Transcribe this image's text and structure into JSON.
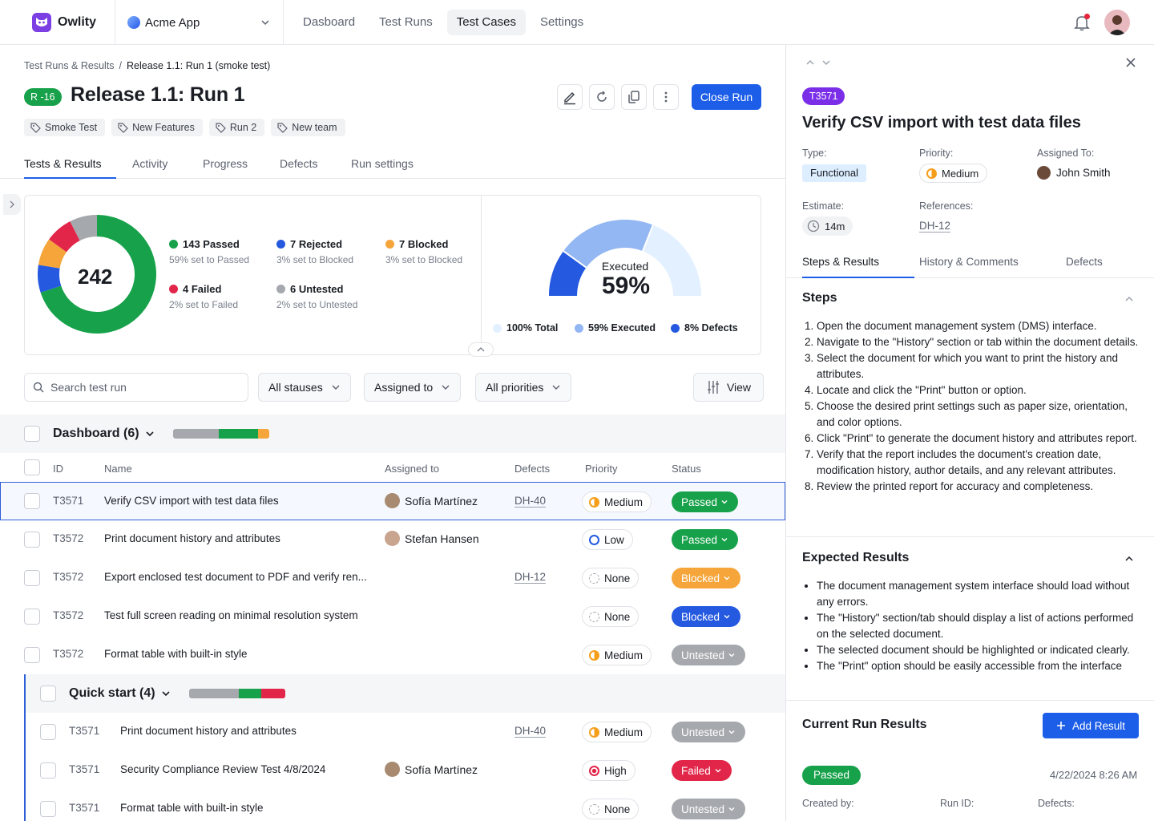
{
  "topbar": {
    "brand": "Owlity",
    "app_name": "Acme App",
    "nav": [
      "Dasboard",
      "Test Runs",
      "Test Cases",
      "Settings"
    ],
    "active_nav": "Test Cases"
  },
  "breadcrumb": {
    "parent": "Test Runs & Results",
    "separator": "/",
    "current": "Release 1.1: Run 1 (smoke test)"
  },
  "run": {
    "id_badge": "R -16",
    "title": "Release 1.1: Run 1",
    "close_label": "Close Run",
    "tags": [
      "Smoke Test",
      "New Features",
      "Run 2",
      "New team"
    ]
  },
  "tabs": [
    "Tests & Results",
    "Activity",
    "Progress",
    "Defects",
    "Run settings"
  ],
  "summary": {
    "total": "242",
    "legend": [
      {
        "label": "143 Passed",
        "sub": "59% set to Passed",
        "color": "#17a14a"
      },
      {
        "label": "7 Rejected",
        "sub": "3% set to Blocked",
        "color": "#2459e0"
      },
      {
        "label": "7 Blocked",
        "sub": "3% set to Blocked",
        "color": "#f5a53a"
      },
      {
        "label": "4 Failed",
        "sub": "2% set to Failed",
        "color": "#e2264a"
      },
      {
        "label": "6 Untested",
        "sub": "2% set to Untested",
        "color": "#a5a8ad"
      }
    ],
    "gauge_label": "Executed",
    "gauge_value": "59%",
    "gauge_legend": [
      {
        "label": "100% Total",
        "color": "#e3f0ff"
      },
      {
        "label": "59% Executed",
        "color": "#93b7f3"
      },
      {
        "label": "8% Defects",
        "color": "#2459e0"
      }
    ]
  },
  "chart_data": [
    {
      "type": "pie",
      "title": "",
      "categories": [
        "Passed",
        "Rejected",
        "Blocked",
        "Failed",
        "Untested"
      ],
      "values": [
        143,
        7,
        7,
        4,
        6
      ],
      "center_label": "242"
    },
    {
      "type": "gauge",
      "title": "Executed",
      "categories": [
        "Total",
        "Executed",
        "Defects"
      ],
      "values": [
        100,
        59,
        8
      ],
      "unit": "%"
    }
  ],
  "filters": {
    "search_placeholder": "Search test run",
    "status": "All stauses",
    "assigned": "Assigned to",
    "priorities": "All priorities",
    "view": "View"
  },
  "columns": [
    "ID",
    "Name",
    "Assigned to",
    "Defects",
    "Priority",
    "Status"
  ],
  "groups": [
    {
      "name": "Dashboard (6)",
      "rows": [
        {
          "id": "T3571",
          "name": "Verify CSV import with test data files",
          "assignee": "Sofía Martínez",
          "defect": "DH-40",
          "priority": "Medium",
          "status": "Passed"
        },
        {
          "id": "T3572",
          "name": "Print document history and attributes",
          "assignee": "Stefan Hansen",
          "defect": "",
          "priority": "Low",
          "status": "Passed"
        },
        {
          "id": "T3572",
          "name": "Export enclosed test document to PDF and verify ren...",
          "assignee": "",
          "defect": "DH-12",
          "priority": "None",
          "status": "Blocked"
        },
        {
          "id": "T3572",
          "name": "Test full screen reading on minimal resolution system",
          "assignee": "",
          "defect": "",
          "priority": "None",
          "status": "Blocked"
        },
        {
          "id": "T3572",
          "name": "Format table with built-in style",
          "assignee": "",
          "defect": "",
          "priority": "Medium",
          "status": "Untested"
        }
      ]
    },
    {
      "name": "Quick start (4)",
      "rows": [
        {
          "id": "T3571",
          "name": "Print document history and attributes",
          "assignee": "",
          "defect": "DH-40",
          "priority": "Medium",
          "status": "Untested"
        },
        {
          "id": "T3571",
          "name": "Security Compliance Review Test 4/8/2024",
          "assignee": "Sofía Martínez",
          "defect": "",
          "priority": "High",
          "status": "Failed"
        },
        {
          "id": "T3571",
          "name": "Format table with built-in style",
          "assignee": "",
          "defect": "",
          "priority": "None",
          "status": "Untested"
        }
      ]
    }
  ],
  "detail": {
    "id_badge": "T3571",
    "title": "Verify CSV import with test data files",
    "type_label": "Type:",
    "type": "Functional",
    "priority_label": "Priority:",
    "priority": "Medium",
    "assigned_label": "Assigned To:",
    "assigned": "John Smith",
    "estimate_label": "Estimate:",
    "estimate": "14m",
    "references_label": "References:",
    "reference": "DH-12",
    "tabs": [
      "Steps & Results",
      "History & Comments",
      "Defects"
    ],
    "steps_title": "Steps",
    "steps": [
      "Open the document management system (DMS) interface.",
      "Navigate to the \"History\" section or tab within the document details.",
      "Select the document for which you want to print the history and attributes.",
      "Locate and click the \"Print\" button or option.",
      "Choose the desired print settings such as paper size, orientation, and color options.",
      "Click \"Print\" to generate the document history and attributes report.",
      "Verify that the report includes the document's creation date, modification history, author details, and any relevant attributes.",
      "Review the printed report for accuracy and completeness."
    ],
    "expected_title": "Expected Results",
    "expected": [
      "The document management system interface should load without any errors.",
      "The \"History\" section/tab should display a list of actions performed on the selected document.",
      "The selected document should be highlighted or indicated clearly.",
      "The \"Print\" option should be easily accessible from the interface"
    ],
    "current_title": "Current Run Results",
    "add_result": "Add Result",
    "result_status": "Passed",
    "result_date": "4/22/2024 8:26 AM",
    "created_by_label": "Created by:",
    "run_id_label": "Run ID:",
    "defects_label": "Defects:"
  }
}
